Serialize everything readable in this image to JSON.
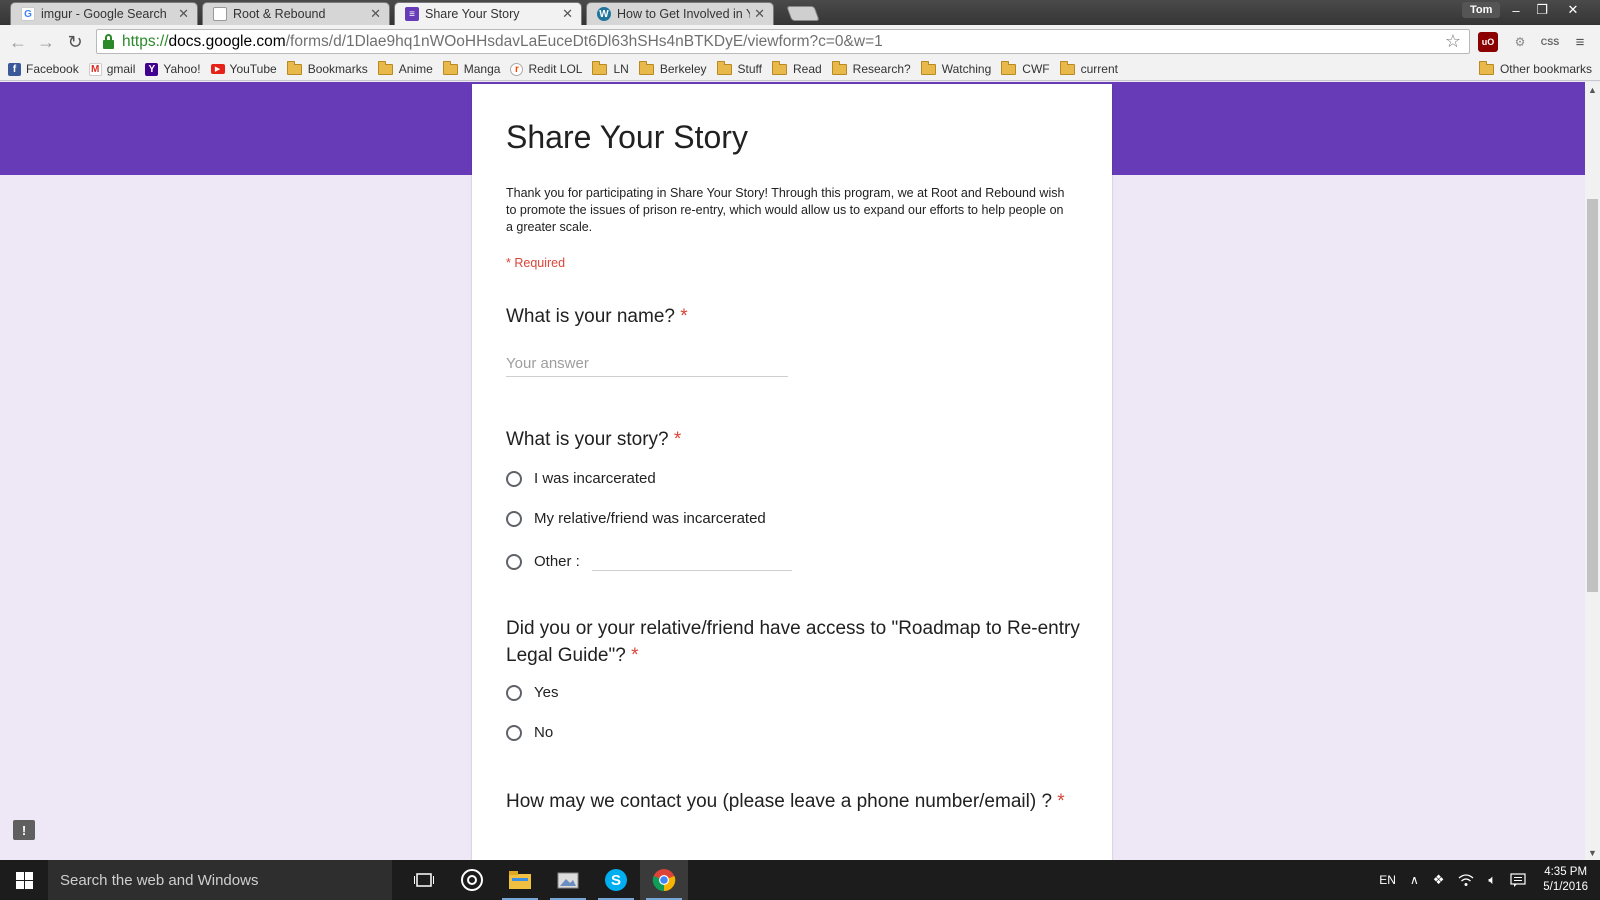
{
  "browser": {
    "tabs": [
      {
        "title": "imgur - Google Search",
        "icon": "google-icon",
        "active": false
      },
      {
        "title": "Root & Rebound",
        "icon": "page-icon",
        "active": false
      },
      {
        "title": "Share Your Story",
        "icon": "forms-icon",
        "active": true
      },
      {
        "title": "How to Get Involved in Yo",
        "icon": "wordpress-icon",
        "active": false
      }
    ],
    "profile_name": "Tom",
    "url": {
      "scheme": "https://",
      "domain": "docs.google.com",
      "path": "/forms/d/1Dlae9hq1nWOoHHsdavLaEuceDt6Dl63hSHs4nBTKDyE/viewform?c=0&w=1"
    },
    "extensions": [
      "ublock-icon",
      "extension-icon",
      "css-icon",
      "menu-icon"
    ],
    "bookmarks": [
      {
        "label": "Facebook",
        "icon": "facebook-icon"
      },
      {
        "label": "gmail",
        "icon": "gmail-icon"
      },
      {
        "label": "Yahoo!",
        "icon": "yahoo-icon"
      },
      {
        "label": "YouTube",
        "icon": "youtube-icon"
      },
      {
        "label": "Bookmarks",
        "icon": "folder-icon"
      },
      {
        "label": "Anime",
        "icon": "folder-icon"
      },
      {
        "label": "Manga",
        "icon": "folder-icon"
      },
      {
        "label": "Redit LOL",
        "icon": "reddit-icon"
      },
      {
        "label": "LN",
        "icon": "folder-icon"
      },
      {
        "label": "Berkeley",
        "icon": "folder-icon"
      },
      {
        "label": "Stuff",
        "icon": "folder-icon"
      },
      {
        "label": "Read",
        "icon": "folder-icon"
      },
      {
        "label": "Research?",
        "icon": "folder-icon"
      },
      {
        "label": "Watching",
        "icon": "folder-icon"
      },
      {
        "label": "CWF",
        "icon": "folder-icon"
      },
      {
        "label": "current",
        "icon": "folder-icon"
      }
    ],
    "other_bookmarks": "Other bookmarks"
  },
  "form": {
    "title": "Share Your Story",
    "description": "Thank you for participating in Share Your Story! Through this program, we at Root and Rebound wish to promote the issues of prison re-entry, which would allow us to expand our efforts to help people on a greater scale.",
    "required_note": "* Required",
    "required_mark": "*",
    "questions": [
      {
        "title": "What is your name?",
        "type": "text",
        "placeholder": "Your answer"
      },
      {
        "title": "What is your story?",
        "type": "radio",
        "options": [
          "I was incarcerated",
          "My relative/friend was incarcerated",
          "Other :"
        ]
      },
      {
        "title": "Did you or your relative/friend have access to \"Roadmap to Re-entry Legal Guide\"?",
        "type": "radio",
        "options": [
          "Yes",
          "No"
        ]
      },
      {
        "title": "How may we contact you (please leave a phone number/email) ?",
        "type": "text"
      }
    ]
  },
  "colors": {
    "banner": "#673ab7",
    "page_bg": "#ede7f6",
    "required": "#db4437"
  },
  "taskbar": {
    "search_placeholder": "Search the web and Windows",
    "apps": [
      "task-view-icon",
      "groove-music-icon",
      "file-explorer-icon",
      "photos-icon",
      "skype-icon",
      "chrome-icon"
    ],
    "language": "EN",
    "time": "4:35 PM",
    "date": "5/1/2016"
  }
}
